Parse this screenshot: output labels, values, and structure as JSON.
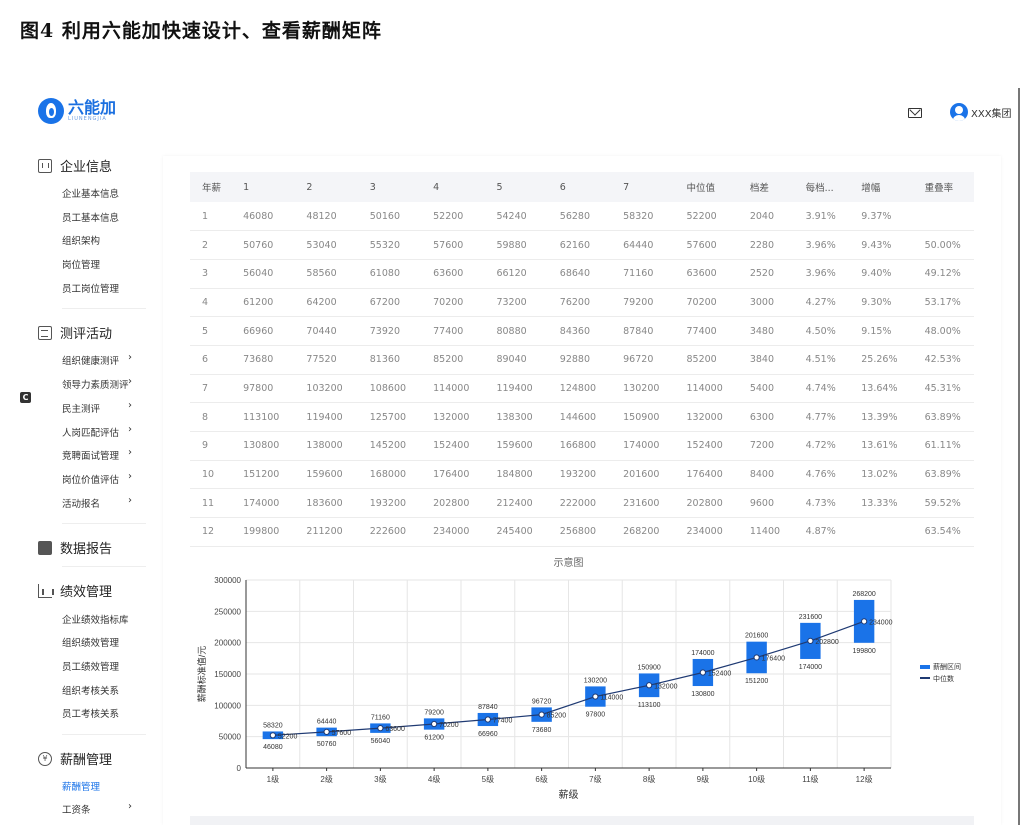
{
  "figure_title": "图4 利用六能加快速设计、查看薪酬矩阵",
  "header": {
    "logo_cn": "六能加",
    "logo_en": "LIUNENGJIA",
    "company": "XXX集团"
  },
  "sidebar": {
    "groups": [
      {
        "label": "企业信息",
        "icon": "building-icon",
        "items": [
          {
            "label": "企业基本信息"
          },
          {
            "label": "员工基本信息"
          },
          {
            "label": "组织架构"
          },
          {
            "label": "岗位管理"
          },
          {
            "label": "员工岗位管理"
          }
        ]
      },
      {
        "label": "测评活动",
        "icon": "clipboard-icon",
        "items": [
          {
            "label": "组织健康测评",
            "arrow": "›"
          },
          {
            "label": "领导力素质测评",
            "arrow": "›"
          },
          {
            "label": "民主测评",
            "arrow": "›"
          },
          {
            "label": "人岗匹配评估",
            "arrow": "›"
          },
          {
            "label": "竞聘面试管理",
            "arrow": "›"
          },
          {
            "label": "岗位价值评估",
            "arrow": "›"
          },
          {
            "label": "活动报名",
            "arrow": "›"
          }
        ]
      },
      {
        "label": "数据报告",
        "icon": "file-icon",
        "items": []
      },
      {
        "label": "绩效管理",
        "icon": "bar-chart-icon",
        "items": [
          {
            "label": "企业绩效指标库"
          },
          {
            "label": "组织绩效管理"
          },
          {
            "label": "员工绩效管理"
          },
          {
            "label": "组织考核关系"
          },
          {
            "label": "员工考核关系"
          }
        ]
      },
      {
        "label": "薪酬管理",
        "icon": "yen-icon",
        "items": [
          {
            "label": "薪酬管理",
            "active": true
          },
          {
            "label": "工资条",
            "arrow": "›"
          }
        ]
      }
    ],
    "badge": "C"
  },
  "table": {
    "headers": [
      "年薪",
      "1",
      "2",
      "3",
      "4",
      "5",
      "6",
      "7",
      "中位值",
      "档差",
      "每档...",
      "增幅",
      "重叠率"
    ],
    "rows": [
      [
        "1",
        "46080",
        "48120",
        "50160",
        "52200",
        "54240",
        "56280",
        "58320",
        "52200",
        "2040",
        "3.91%",
        "9.37%",
        ""
      ],
      [
        "2",
        "50760",
        "53040",
        "55320",
        "57600",
        "59880",
        "62160",
        "64440",
        "57600",
        "2280",
        "3.96%",
        "9.43%",
        "50.00%"
      ],
      [
        "3",
        "56040",
        "58560",
        "61080",
        "63600",
        "66120",
        "68640",
        "71160",
        "63600",
        "2520",
        "3.96%",
        "9.40%",
        "49.12%"
      ],
      [
        "4",
        "61200",
        "64200",
        "67200",
        "70200",
        "73200",
        "76200",
        "79200",
        "70200",
        "3000",
        "4.27%",
        "9.30%",
        "53.17%"
      ],
      [
        "5",
        "66960",
        "70440",
        "73920",
        "77400",
        "80880",
        "84360",
        "87840",
        "77400",
        "3480",
        "4.50%",
        "9.15%",
        "48.00%"
      ],
      [
        "6",
        "73680",
        "77520",
        "81360",
        "85200",
        "89040",
        "92880",
        "96720",
        "85200",
        "3840",
        "4.51%",
        "25.26%",
        "42.53%"
      ],
      [
        "7",
        "97800",
        "103200",
        "108600",
        "114000",
        "119400",
        "124800",
        "130200",
        "114000",
        "5400",
        "4.74%",
        "13.64%",
        "45.31%"
      ],
      [
        "8",
        "113100",
        "119400",
        "125700",
        "132000",
        "138300",
        "144600",
        "150900",
        "132000",
        "6300",
        "4.77%",
        "13.39%",
        "63.89%"
      ],
      [
        "9",
        "130800",
        "138000",
        "145200",
        "152400",
        "159600",
        "166800",
        "174000",
        "152400",
        "7200",
        "4.72%",
        "13.61%",
        "61.11%"
      ],
      [
        "10",
        "151200",
        "159600",
        "168000",
        "176400",
        "184800",
        "193200",
        "201600",
        "176400",
        "8400",
        "4.76%",
        "13.02%",
        "63.89%"
      ],
      [
        "11",
        "174000",
        "183600",
        "193200",
        "202800",
        "212400",
        "222000",
        "231600",
        "202800",
        "9600",
        "4.73%",
        "13.33%",
        "59.52%"
      ],
      [
        "12",
        "199800",
        "211200",
        "222600",
        "234000",
        "245400",
        "256800",
        "268200",
        "234000",
        "11400",
        "4.87%",
        "",
        "63.54%"
      ]
    ]
  },
  "colors": {
    "bar": "#1a73e8",
    "line": "#1f3a73",
    "accent": "#1a73e8"
  },
  "chart_data": {
    "type": "bar",
    "title": "示意图",
    "xlabel": "薪级",
    "ylabel": "薪酬标准值/元",
    "categories": [
      "1级",
      "2级",
      "3级",
      "4级",
      "5级",
      "6级",
      "7级",
      "8级",
      "9级",
      "10级",
      "11级",
      "12级"
    ],
    "ylim": [
      0,
      300000
    ],
    "yticks": [
      "0",
      "50000",
      "100000",
      "150000",
      "200000",
      "250000",
      "300000"
    ],
    "grid": true,
    "legend": "right",
    "series": [
      {
        "name": "薪酬区间",
        "kind": "range",
        "min": [
          46080,
          50760,
          56040,
          61200,
          66960,
          73680,
          97800,
          113100,
          130800,
          151200,
          174000,
          199800
        ],
        "max": [
          58320,
          64440,
          71160,
          79200,
          87840,
          96720,
          130200,
          150900,
          174000,
          201600,
          231600,
          268200
        ]
      },
      {
        "name": "中位数",
        "kind": "line",
        "values": [
          52200,
          57600,
          63600,
          70200,
          77400,
          85200,
          114000,
          132000,
          152400,
          176400,
          202800,
          234000
        ]
      }
    ]
  }
}
